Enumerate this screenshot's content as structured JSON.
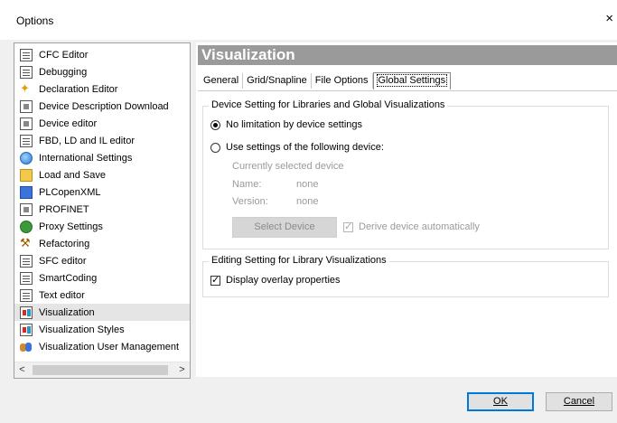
{
  "window": {
    "title": "Options",
    "close_glyph": "×"
  },
  "tree": {
    "items": [
      {
        "label": "CFC Editor",
        "icon": "doc"
      },
      {
        "label": "Debugging",
        "icon": "doc"
      },
      {
        "label": "Declaration Editor",
        "icon": "sparkle"
      },
      {
        "label": "Device Description Download",
        "icon": "chip"
      },
      {
        "label": "Device editor",
        "icon": "chip"
      },
      {
        "label": "FBD, LD and IL editor",
        "icon": "doc"
      },
      {
        "label": "International Settings",
        "icon": "globe"
      },
      {
        "label": "Load and Save",
        "icon": "folder"
      },
      {
        "label": "PLCopenXML",
        "icon": "blue"
      },
      {
        "label": "PROFINET",
        "icon": "chip"
      },
      {
        "label": "Proxy Settings",
        "icon": "proxy"
      },
      {
        "label": "Refactoring",
        "icon": "refactor"
      },
      {
        "label": "SFC editor",
        "icon": "doc"
      },
      {
        "label": "SmartCoding",
        "icon": "doc"
      },
      {
        "label": "Text editor",
        "icon": "doc"
      },
      {
        "label": "Visualization",
        "icon": "visu",
        "selected": true
      },
      {
        "label": "Visualization Styles",
        "icon": "visu"
      },
      {
        "label": "Visualization User Management",
        "icon": "users"
      }
    ],
    "scroll_left": "<",
    "scroll_right": ">"
  },
  "panel": {
    "header": "Visualization",
    "tabs": [
      "General",
      "Grid/Snapline",
      "File Options",
      "Global Settings"
    ],
    "active_tab": "Global Settings",
    "device_group": {
      "legend": "Device Setting for Libraries and Global Visualizations",
      "radio_no_limit": "No limitation by device settings",
      "radio_use_device": "Use settings of the following device:",
      "currently_selected": "Currently selected device",
      "name_label": "Name:",
      "name_value": "none",
      "version_label": "Version:",
      "version_value": "none",
      "select_device_button": "Select Device",
      "derive_auto": "Derive device automatically"
    },
    "editing_group": {
      "legend": "Editing Setting for Library Visualizations",
      "display_overlay": "Display overlay properties"
    }
  },
  "buttons": {
    "ok": "OK",
    "cancel": "Cancel"
  }
}
